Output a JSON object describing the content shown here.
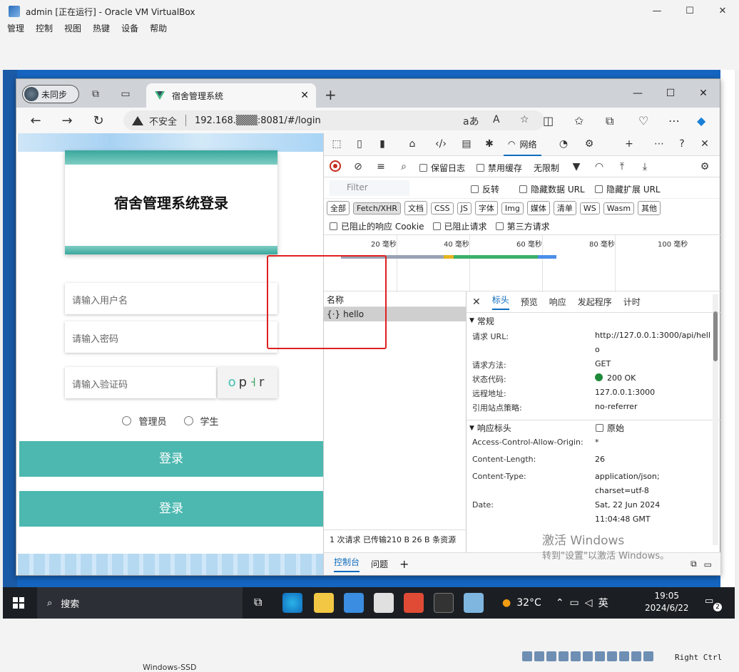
{
  "vbox": {
    "title": "admin [正在运行] - Oracle VM VirtualBox",
    "menu": [
      "管理",
      "控制",
      "视图",
      "热键",
      "设备",
      "帮助"
    ],
    "window_controls": [
      "—",
      "☐",
      "✕"
    ]
  },
  "browser": {
    "profile_label": "未同步",
    "tab_title": "宿舍管理系统",
    "tab_close": "✕",
    "new_tab": "+",
    "security_label": "不安全",
    "url": "192.168.▒▒▒:8081/#/login",
    "window_controls": [
      "—",
      "☐",
      "✕"
    ]
  },
  "login": {
    "title": "宿舍管理系统登录",
    "username_placeholder": "请输入用户名",
    "password_placeholder": "请输入密码",
    "captcha_placeholder": "请输入验证码",
    "captcha_chars": [
      "o",
      "p",
      "˧",
      "r"
    ],
    "roles": [
      "管理员",
      "学生"
    ],
    "button1": "登录",
    "button2": "登录"
  },
  "devtools": {
    "network_tab": "网络",
    "preserve_log": "保留日志",
    "disable_cache": "禁用缓存",
    "throttle": "无限制",
    "filter_placeholder": "Filter",
    "invert": "反转",
    "hide_data_url": "隐藏数据 URL",
    "hide_ext_url": "隐藏扩展 URL",
    "type_filters": [
      "全部",
      "Fetch/XHR",
      "文档",
      "CSS",
      "JS",
      "字体",
      "Img",
      "媒体",
      "清单",
      "WS",
      "Wasm",
      "其他"
    ],
    "blocked_cookies": "已阻止的响应 Cookie",
    "blocked_requests": "已阻止请求",
    "third_party": "第三方请求",
    "timeline_labels": [
      "20 毫秒",
      "40 毫秒",
      "60 毫秒",
      "80 毫秒",
      "100 毫秒"
    ],
    "name_header": "名称",
    "requests": [
      "hello"
    ],
    "status_summary": "1 次请求  已传输210 B  26 B 条资源",
    "detail_tabs": [
      "标头",
      "预览",
      "响应",
      "发起程序",
      "计时"
    ],
    "general_header": "常规",
    "general": [
      {
        "k": "请求 URL:",
        "v": "http://127.0.0.1:3000/api/hello"
      },
      {
        "k": "请求方法:",
        "v": "GET"
      },
      {
        "k": "状态代码:",
        "v": "200 OK"
      },
      {
        "k": "远程地址:",
        "v": "127.0.0.1:3000"
      },
      {
        "k": "引用站点策略:",
        "v": "no-referrer"
      }
    ],
    "response_headers_header": "响应标头",
    "raw_label": "原始",
    "response_headers": [
      {
        "k": "Access-Control-Allow-Origin:",
        "v": "*"
      },
      {
        "k": "Content-Length:",
        "v": "26"
      },
      {
        "k": "Content-Type:",
        "v": "application/json;"
      },
      {
        "k": "",
        "v": "charset=utf-8"
      },
      {
        "k": "Date:",
        "v": "Sat, 22 Jun 2024"
      },
      {
        "k": "",
        "v": "11:04:48 GMT"
      }
    ],
    "bottom_tabs": [
      "控制台",
      "问题"
    ],
    "bottom_add": "+"
  },
  "watermark": {
    "line1": "激活 Windows",
    "line2": "转到\"设置\"以激活 Windows。"
  },
  "taskbar": {
    "search": "搜索",
    "weather": "32°C",
    "ime": "英",
    "time": "19:05",
    "date": "2024/6/22",
    "notif_count": "2"
  },
  "vbox_status": {
    "host_key": "Right Ctrl",
    "fragment": "Windows-SSD"
  },
  "colors": {
    "teal": "#4cb8b0",
    "devtools_accent": "#0f6cbd",
    "highlight_box": "#e02020"
  }
}
